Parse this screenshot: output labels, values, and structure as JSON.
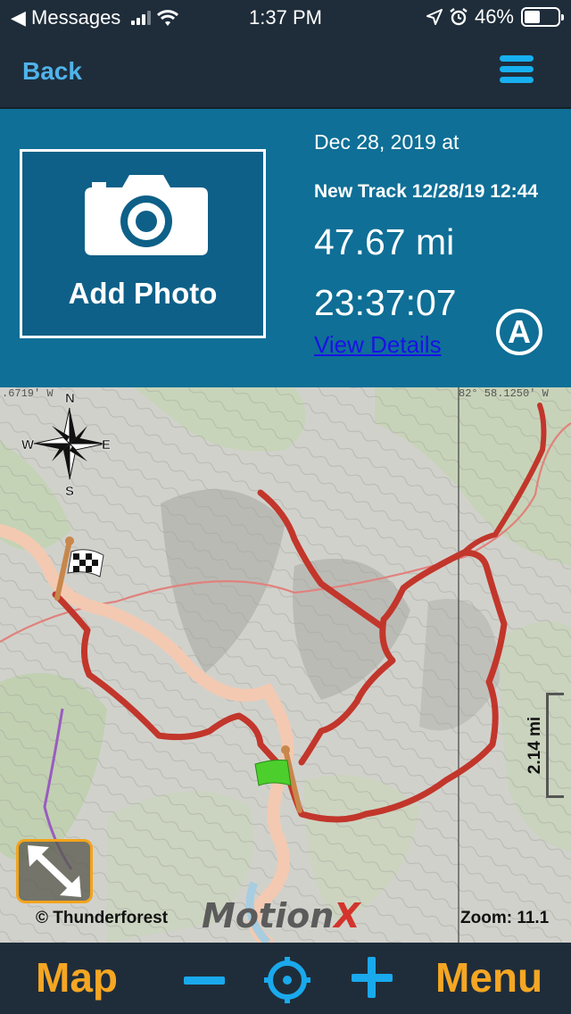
{
  "status_bar": {
    "back_app": "◀ Messages",
    "time": "1:37 PM",
    "battery": "46%",
    "battery_level": 0.46,
    "icons": [
      "signal-icon",
      "wifi-icon",
      "location-arrow-icon",
      "alarm-icon",
      "battery-icon"
    ]
  },
  "nav": {
    "back_label": "Back",
    "menu_icon": "hamburger-menu-icon"
  },
  "track": {
    "add_photo_label": "Add Photo",
    "camera_icon": "camera-icon",
    "date": "Dec 28, 2019 at",
    "name": "New Track 12/28/19 12:44",
    "distance": "47.67 mi",
    "duration": "23:37:07",
    "details_link": "View Details",
    "badge": "A"
  },
  "map": {
    "coord_left": ".6719' W",
    "coord_right": "82° 58.1250' W",
    "compass": {
      "n": "N",
      "s": "S",
      "e": "E",
      "w": "W"
    },
    "scale": "2.14 mi",
    "copyright": "© Thunderforest",
    "logo_main": "Motion",
    "logo_x": "X",
    "zoom": "Zoom: 11.1",
    "track_color": "#c0392b",
    "expand_icon": "expand-arrows-icon",
    "start_flag": "green-flag-icon",
    "finish_flag": "checkered-flag-icon"
  },
  "toolbar": {
    "map_label": "Map",
    "menu_label": "Menu",
    "zoom_out_icon": "minus-icon",
    "locate_icon": "crosshair-locate-icon",
    "zoom_in_icon": "plus-icon",
    "accent": "#f5a623",
    "icon_color": "#1aa9ec"
  }
}
